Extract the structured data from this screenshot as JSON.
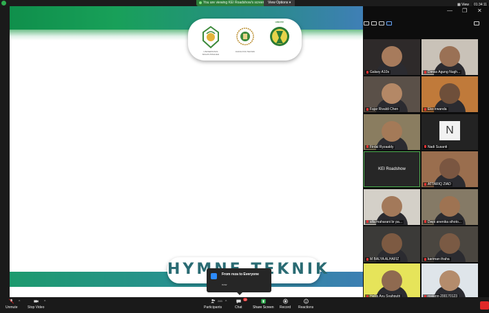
{
  "banner": {
    "text": "You are viewing KEI Roadshow's screen",
    "view_options": "View Options"
  },
  "topright": {
    "view": "View",
    "clock": "01:34:11"
  },
  "share": {
    "logos": [
      {
        "text": "UNIVERSITAS MALIKUSSALEH",
        "color": "#3d8a3b"
      },
      {
        "text": "FAKULTAS TEKNIK",
        "color": "#b98b2a"
      },
      {
        "text": "HIMATIF",
        "color": "#2a7a34"
      }
    ],
    "hymne": "HYMNE TEKNIK"
  },
  "chat_notification": {
    "title": "From reza to Everyone",
    "time": "now"
  },
  "participants": [
    {
      "name": "Galaxy A10s",
      "skin": "#a77b5c",
      "bg": "#2e2a2a",
      "type": "video"
    },
    {
      "name": "Dimas Agung Nugh...",
      "skin": "#9a7155",
      "bg": "#c9c2b8",
      "type": "video"
    },
    {
      "name": "Fajar Rivaldi Chen",
      "skin": "#b48866",
      "bg": "#5a5048",
      "type": "video"
    },
    {
      "name": "Eko irwanda",
      "skin": "#6e4f3a",
      "bg": "#c07a3a",
      "type": "video"
    },
    {
      "name": "Firdal Ryzaaldy",
      "skin": "#a47a58",
      "bg": "#8a7d60",
      "type": "video"
    },
    {
      "name": "Nadi Susanti",
      "initial": "N",
      "type": "avatar"
    },
    {
      "name": "KEI Roadshow",
      "type": "host"
    },
    {
      "name": "ATTARIQ ZIAD",
      "skin": "#7a5641",
      "bg": "#9a6e4e",
      "type": "video"
    },
    {
      "name": "sifa maharani br pa...",
      "skin": "#a3795a",
      "bg": "#d4d0c8",
      "type": "video"
    },
    {
      "name": "Dwpi anenika sihoto...",
      "skin": "#9e7352",
      "bg": "#857a66",
      "type": "video"
    },
    {
      "name": "M BALYA ALHAFIZ",
      "skin": "#7d5a42",
      "bg": "#3b3a38",
      "type": "video"
    },
    {
      "name": "kariman thaha",
      "skin": "#7a5a44",
      "bg": "#4a4640",
      "type": "video"
    },
    {
      "name": "Hellis Ayu Syahputri",
      "skin": "#8f6a50",
      "bg": "#e6e45a",
      "type": "video"
    },
    {
      "name": "rosiann-200170123",
      "skin": "#b48c6c",
      "bg": "#dfe5ea",
      "type": "video"
    }
  ],
  "toolbar": {
    "unmute": "Unmute",
    "stop_video": "Stop Video",
    "participants": "Participants",
    "participant_count": "245",
    "chat": "Chat",
    "chat_badge": "10",
    "share_screen": "Share Screen",
    "record": "Record",
    "reactions": "Reactions"
  },
  "colors": {
    "accent_green": "#2eae4f",
    "toolbar_bg": "#1a1a1a",
    "alert_red": "#e02828",
    "blue": "#2d8cff"
  }
}
